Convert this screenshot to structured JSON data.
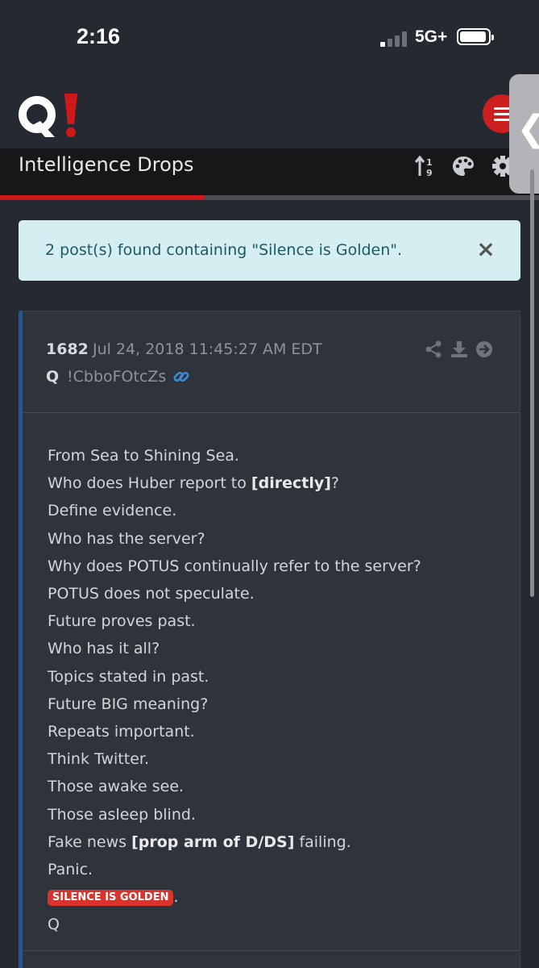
{
  "status_bar": {
    "time": "2:16",
    "network": "5G+"
  },
  "header": {
    "logo_text": "Q!",
    "title": "Intelligence Drops",
    "progress_fraction": 0.38
  },
  "alert": {
    "message": "2 post(s) found containing \"Silence is Golden\".",
    "close_glyph": "×"
  },
  "post": {
    "number": "1682",
    "date": "Jul 24, 2018 11:45:27 AM EDT",
    "author": "Q",
    "tripcode": "!CbboFOtcZs",
    "lines": [
      {
        "text": "From Sea to Shining Sea."
      },
      {
        "pre": "Who does Huber report to ",
        "bold": "[directly]",
        "post": "?"
      },
      {
        "text": "Define evidence."
      },
      {
        "text": "Who has the server?"
      },
      {
        "text": "Why does POTUS continually refer to the server?"
      },
      {
        "text": "POTUS does not speculate."
      },
      {
        "text": "Future proves past."
      },
      {
        "text": "Who has it all?"
      },
      {
        "text": "Topics stated in past."
      },
      {
        "text": "Future BIG meaning?"
      },
      {
        "text": "Repeats important."
      },
      {
        "text": "Think Twitter."
      },
      {
        "text": "Those awake see."
      },
      {
        "text": "Those asleep blind."
      },
      {
        "pre": "Fake news ",
        "bold": "[prop arm of D/DS]",
        "post": " failing."
      },
      {
        "text": "Panic."
      },
      {
        "highlight": "SILENCE IS GOLDEN",
        "post": "."
      },
      {
        "text": "Q"
      }
    ]
  },
  "icons": {
    "menu": "hamburger-icon",
    "sort": "sort-numeric-icon",
    "theme": "palette-icon",
    "settings": "gear-icon",
    "share": "share-icon",
    "download": "download-icon",
    "open": "arrow-circle-right-icon",
    "link": "link-icon",
    "handle": "chevron-left-icon"
  },
  "colors": {
    "brand_red": "#d01818",
    "post_accent": "#1e5a99",
    "alert_bg": "#d5eef1",
    "link_blue": "#3a8ad6"
  }
}
